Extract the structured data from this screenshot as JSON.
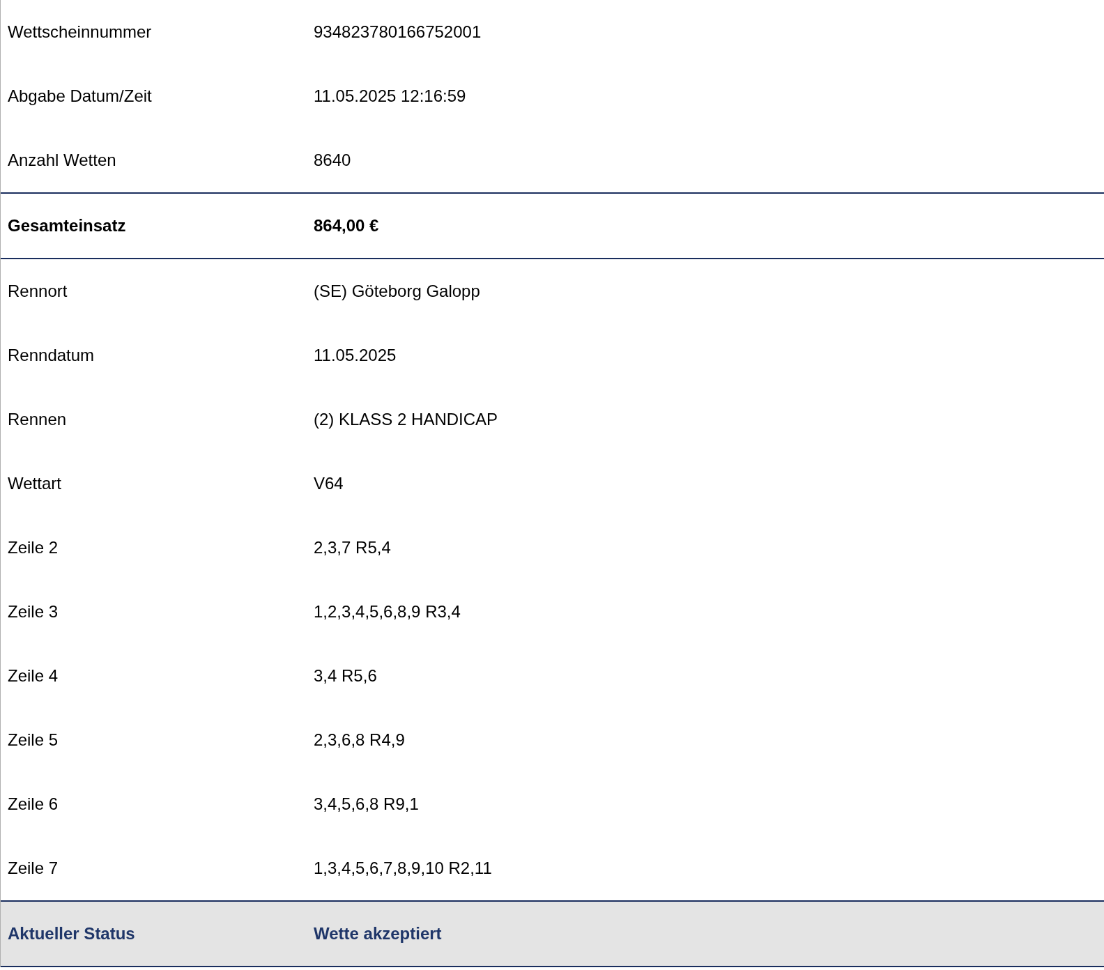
{
  "rows": [
    {
      "kind": "normal",
      "label": "Wettscheinnummer",
      "value": "934823780166752001"
    },
    {
      "kind": "normal",
      "label": "Abgabe Datum/Zeit",
      "value": "11.05.2025 12:16:59"
    },
    {
      "kind": "normal",
      "label": "Anzahl Wetten",
      "value": "8640"
    },
    {
      "kind": "total",
      "label": "Gesamteinsatz",
      "value": "864,00 €"
    },
    {
      "kind": "normal",
      "label": "Rennort",
      "value": "(SE) Göteborg Galopp"
    },
    {
      "kind": "normal",
      "label": "Renndatum",
      "value": "11.05.2025"
    },
    {
      "kind": "normal",
      "label": "Rennen",
      "value": "(2) KLASS 2 HANDICAP"
    },
    {
      "kind": "normal",
      "label": "Wettart",
      "value": "V64"
    },
    {
      "kind": "normal",
      "label": "Zeile 2",
      "value": "2,3,7 R5,4"
    },
    {
      "kind": "normal",
      "label": "Zeile 3",
      "value": "1,2,3,4,5,6,8,9 R3,4"
    },
    {
      "kind": "normal",
      "label": "Zeile 4",
      "value": "3,4 R5,6"
    },
    {
      "kind": "normal",
      "label": "Zeile 5",
      "value": "2,3,6,8 R4,9"
    },
    {
      "kind": "normal",
      "label": "Zeile 6",
      "value": "3,4,5,6,8 R9,1"
    },
    {
      "kind": "normal",
      "label": "Zeile 7",
      "value": "1,3,4,5,6,7,8,9,10 R2,11"
    },
    {
      "kind": "status",
      "label": "Aktueller Status",
      "value": "Wette akzeptiert"
    }
  ]
}
